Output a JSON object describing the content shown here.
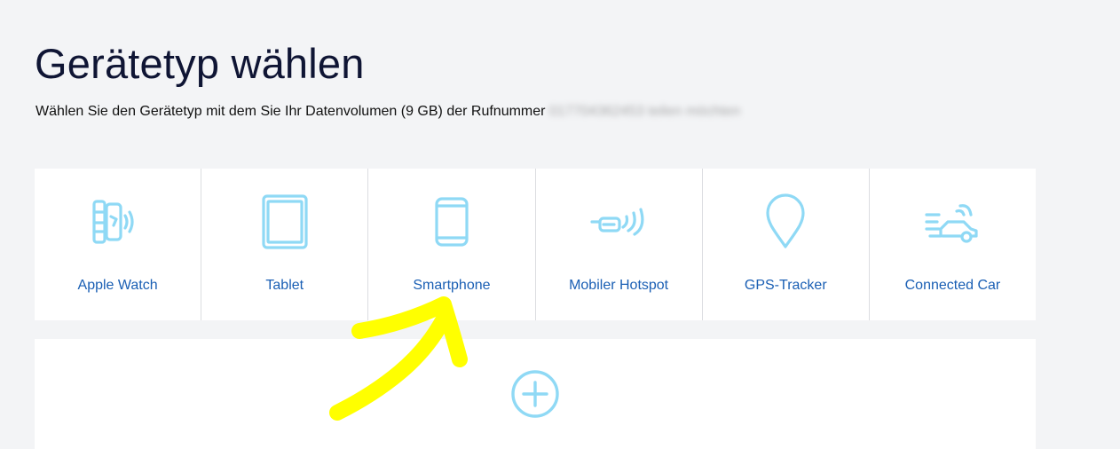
{
  "header": {
    "title": "Gerätetyp wählen",
    "subtitle_prefix": "Wählen Sie den Gerätetyp mit dem Sie Ihr Datenvolumen (9 GB) der Rufnummer",
    "subtitle_redacted": "017704362453 teilen möchten"
  },
  "devices": [
    {
      "label": "Apple Watch",
      "icon": "smartwatch-icon"
    },
    {
      "label": "Tablet",
      "icon": "tablet-icon"
    },
    {
      "label": "Smartphone",
      "icon": "smartphone-icon"
    },
    {
      "label": "Mobiler Hotspot",
      "icon": "hotspot-icon"
    },
    {
      "label": "GPS-Tracker",
      "icon": "location-pin-icon"
    },
    {
      "label": "Connected Car",
      "icon": "connected-car-icon"
    }
  ],
  "add_panel": {
    "icon": "plus-circle-icon"
  },
  "colors": {
    "background": "#f3f4f6",
    "card": "#ffffff",
    "icon": "#8fd9f5",
    "label": "#1a5fb4",
    "title": "#0f1534",
    "annotation": "#ffff00"
  }
}
